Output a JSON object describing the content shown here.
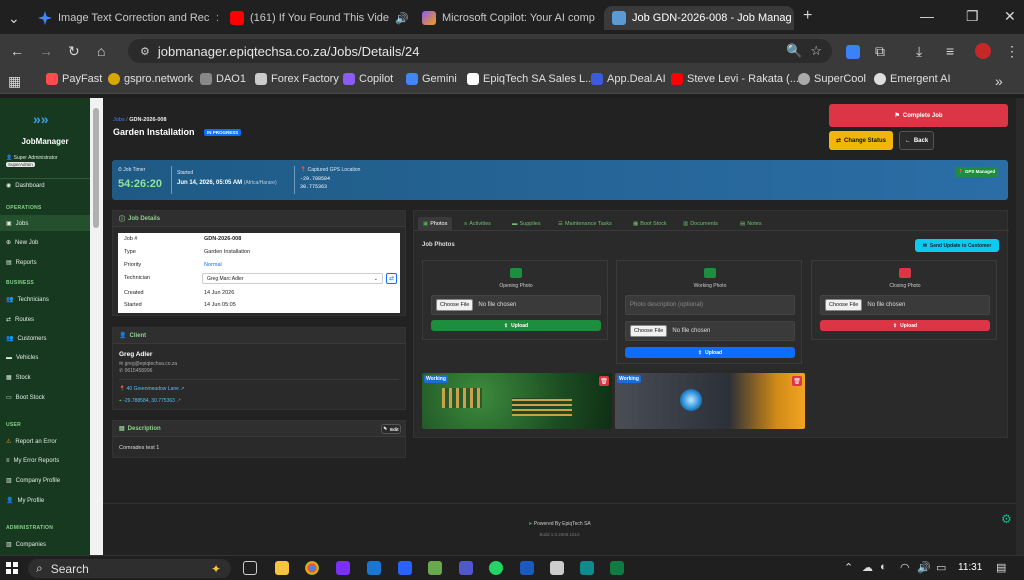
{
  "browser": {
    "tabs": [
      {
        "title": "Image Text Correction and Rec",
        "favicon_color": "#4285f4",
        "icon": "gemini-icon"
      },
      {
        "title": "(161) If You Found This Vide",
        "favicon_color": "#ff0000",
        "icon": "youtube-icon"
      },
      {
        "title": "Microsoft Copilot: Your AI comp",
        "favicon_color": "#8a5cf6",
        "icon": "copilot-icon"
      },
      {
        "title": "Job GDN-2026-008 - Job Manag",
        "favicon_color": "#5b9bd5",
        "icon": "page-icon"
      }
    ],
    "url": "jobmanager.epiqtechsa.co.za/Jobs/Details/24",
    "bookmarks": [
      {
        "label": "PayFast",
        "color": "#ff4d4d"
      },
      {
        "label": "gspro.network",
        "color": "#d9a800"
      },
      {
        "label": "DAO1",
        "color": "#888888"
      },
      {
        "label": "Forex Factory",
        "color": "#cccccc"
      },
      {
        "label": "Copilot",
        "color": "#8a5cf6"
      },
      {
        "label": "Gemini",
        "color": "#4285f4"
      },
      {
        "label": "EpiqTech SA Sales L...",
        "color": "#ffffff"
      },
      {
        "label": "App.Deal.AI",
        "color": "#3b5bdb"
      },
      {
        "label": "Steve Levi - Rakata (...",
        "color": "#ff0000"
      },
      {
        "label": "SuperCool",
        "color": "#aaaaaa"
      },
      {
        "label": "Emergent AI",
        "color": "#dddddd"
      }
    ]
  },
  "sidebar": {
    "app_name": "JobManager",
    "user_role": "Super Administrator",
    "user_badge": "SuperAdmin",
    "dashboard": "Dashboard",
    "sections": [
      {
        "label": "OPERATIONS",
        "items": [
          "Jobs",
          "New Job",
          "Reports"
        ]
      },
      {
        "label": "BUSINESS",
        "items": [
          "Technicians",
          "Routes",
          "Customers",
          "Vehicles",
          "Stock",
          "Boot Stock"
        ]
      },
      {
        "label": "USER",
        "items": [
          "Report an Error",
          "My Error Reports",
          "Company Profile",
          "My Profile"
        ]
      },
      {
        "label": "ADMINISTRATION",
        "items": [
          "Companies"
        ]
      }
    ]
  },
  "header": {
    "breadcrumb_root": "Jobs",
    "breadcrumb_current": "GDN-2026-008",
    "title": "Garden Installation",
    "status": "IN PROGRESS",
    "complete_btn": "Complete Job",
    "change_status_btn": "Change Status",
    "back_btn": "Back"
  },
  "timer": {
    "label": "Job Timer",
    "value": "54:26:20",
    "started_label": "Started",
    "started_value": "Jun 14, 2026, 05:05 AM",
    "timezone": "(Africa/Harare)",
    "gps_label": "Captured GPS Location",
    "gps_lat": "-29.788584",
    "gps_lng": "30.775363",
    "gps_badge": "GPS Managed"
  },
  "job_details": {
    "title": "Job Details",
    "rows": [
      {
        "k": "Job #",
        "v": "GDN-2026-008"
      },
      {
        "k": "Type",
        "v": "Garden Installation"
      },
      {
        "k": "Priority",
        "v": "Normal"
      },
      {
        "k": "Technician",
        "v": "Greg Marc Adler"
      },
      {
        "k": "Created",
        "v": "14 Jun 2026"
      },
      {
        "k": "Started",
        "v": "14 Jun 05:05"
      }
    ]
  },
  "client": {
    "title": "Client",
    "name": "Greg Adler",
    "email": "greg@epiqtechsa.co.za",
    "phone": "0615458996",
    "address": "40 Greenmeadow Lane",
    "coords": "-29.788584, 30.775363"
  },
  "description": {
    "title": "Description",
    "edit": "Edit",
    "text": "Comrades test 1"
  },
  "tabs": [
    "Photos",
    "Activities",
    "Supplies",
    "Maintenance Tasks",
    "Boot Stock",
    "Documents",
    "Notes"
  ],
  "photos": {
    "title": "Job Photos",
    "send_btn": "Send Update to Customer",
    "cards": [
      {
        "title": "Opening Photo",
        "choose": "Choose File",
        "nofile": "No file chosen",
        "upload": "Upload",
        "color": "#1e8e3e"
      },
      {
        "title": "Working Photo",
        "placeholder": "Photo description (optional)",
        "choose": "Choose File",
        "nofile": "No file chosen",
        "upload": "Upload",
        "color": "#0d6efd"
      },
      {
        "title": "Closing Photo",
        "choose": "Choose File",
        "nofile": "No file chosen",
        "upload": "Upload",
        "color": "#dc3545"
      }
    ],
    "thumbs": [
      {
        "tag": "Working"
      },
      {
        "tag": "Working"
      }
    ]
  },
  "footer": {
    "powered": "Powered By EpiqTech SA",
    "build": "Build 1.0.2606.1510"
  },
  "taskbar": {
    "search": "Search",
    "time": "11:31"
  }
}
